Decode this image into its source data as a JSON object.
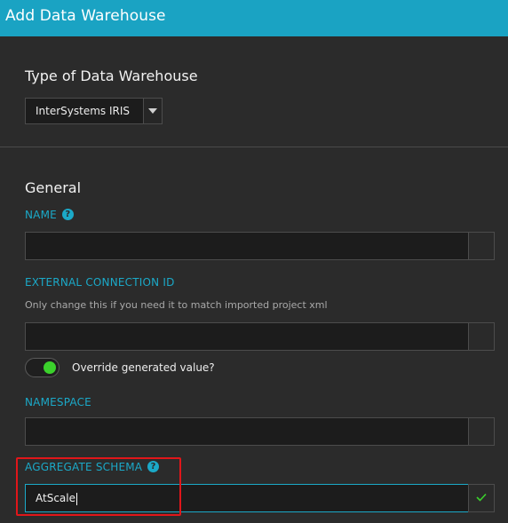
{
  "window": {
    "title": "Add Data Warehouse"
  },
  "type_section": {
    "heading": "Type of Data Warehouse",
    "select_value": "InterSystems IRIS"
  },
  "general_section": {
    "heading": "General",
    "name": {
      "label": "NAME",
      "value": ""
    },
    "external_connection_id": {
      "label": "EXTERNAL CONNECTION ID",
      "hint": "Only change this if you need it to match imported project xml",
      "value": ""
    },
    "override_toggle": {
      "label": "Override generated value?",
      "on": true
    },
    "namespace": {
      "label": "NAMESPACE",
      "value": ""
    },
    "aggregate_schema": {
      "label": "AGGREGATE SCHEMA",
      "value": "AtScale",
      "valid": true
    }
  },
  "colors": {
    "accent": "#1aa3c3",
    "background": "#2b2b2b",
    "toggle_on": "#3bd12c",
    "valid_check": "#3bd12c",
    "highlight": "#e0161a"
  },
  "icons": {
    "help": "help-circle-icon",
    "dropdown": "chevron-down-icon",
    "valid": "checkmark-icon"
  }
}
